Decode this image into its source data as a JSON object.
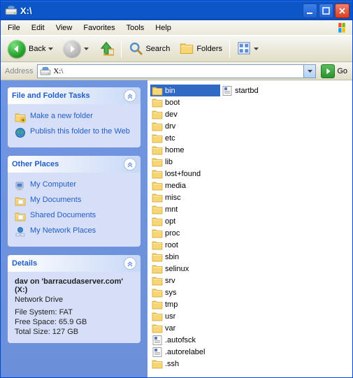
{
  "window": {
    "title": "X:\\"
  },
  "menu": {
    "file": "File",
    "edit": "Edit",
    "view": "View",
    "favorites": "Favorites",
    "tools": "Tools",
    "help": "Help"
  },
  "toolbar": {
    "back": "Back",
    "search": "Search",
    "folders": "Folders"
  },
  "address": {
    "label": "Address",
    "value": "X:\\",
    "go": "Go"
  },
  "sidebar": {
    "tasks": {
      "title": "File and Folder Tasks",
      "items": [
        {
          "label": "Make a new folder"
        },
        {
          "label": "Publish this folder to the Web"
        }
      ]
    },
    "places": {
      "title": "Other Places",
      "items": [
        {
          "label": "My Computer"
        },
        {
          "label": "My Documents"
        },
        {
          "label": "Shared Documents"
        },
        {
          "label": "My Network Places"
        }
      ]
    },
    "details": {
      "title": "Details",
      "name": "dav on 'barracudaserver.com' (X:)",
      "type": "Network Drive",
      "filesystem": "File System: FAT",
      "free": "Free Space: 65.9 GB",
      "total": "Total Size: 127 GB"
    }
  },
  "files": {
    "col1": [
      {
        "name": "bin",
        "type": "folder",
        "selected": true
      },
      {
        "name": "boot",
        "type": "folder"
      },
      {
        "name": "dev",
        "type": "folder"
      },
      {
        "name": "drv",
        "type": "folder"
      },
      {
        "name": "etc",
        "type": "folder"
      },
      {
        "name": "home",
        "type": "folder"
      },
      {
        "name": "lib",
        "type": "folder"
      },
      {
        "name": "lost+found",
        "type": "folder"
      },
      {
        "name": "media",
        "type": "folder"
      },
      {
        "name": "misc",
        "type": "folder"
      },
      {
        "name": "mnt",
        "type": "folder"
      },
      {
        "name": "opt",
        "type": "folder"
      },
      {
        "name": "proc",
        "type": "folder"
      },
      {
        "name": "root",
        "type": "folder"
      },
      {
        "name": "sbin",
        "type": "folder"
      },
      {
        "name": "selinux",
        "type": "folder"
      },
      {
        "name": "srv",
        "type": "folder"
      },
      {
        "name": "sys",
        "type": "folder"
      },
      {
        "name": "tmp",
        "type": "folder"
      },
      {
        "name": "usr",
        "type": "folder"
      },
      {
        "name": "var",
        "type": "folder"
      },
      {
        "name": ".autofsck",
        "type": "file"
      },
      {
        "name": ".autorelabel",
        "type": "file"
      }
    ],
    "col2": [
      {
        "name": ".ssh",
        "type": "folder"
      },
      {
        "name": "startbd",
        "type": "file"
      }
    ]
  }
}
